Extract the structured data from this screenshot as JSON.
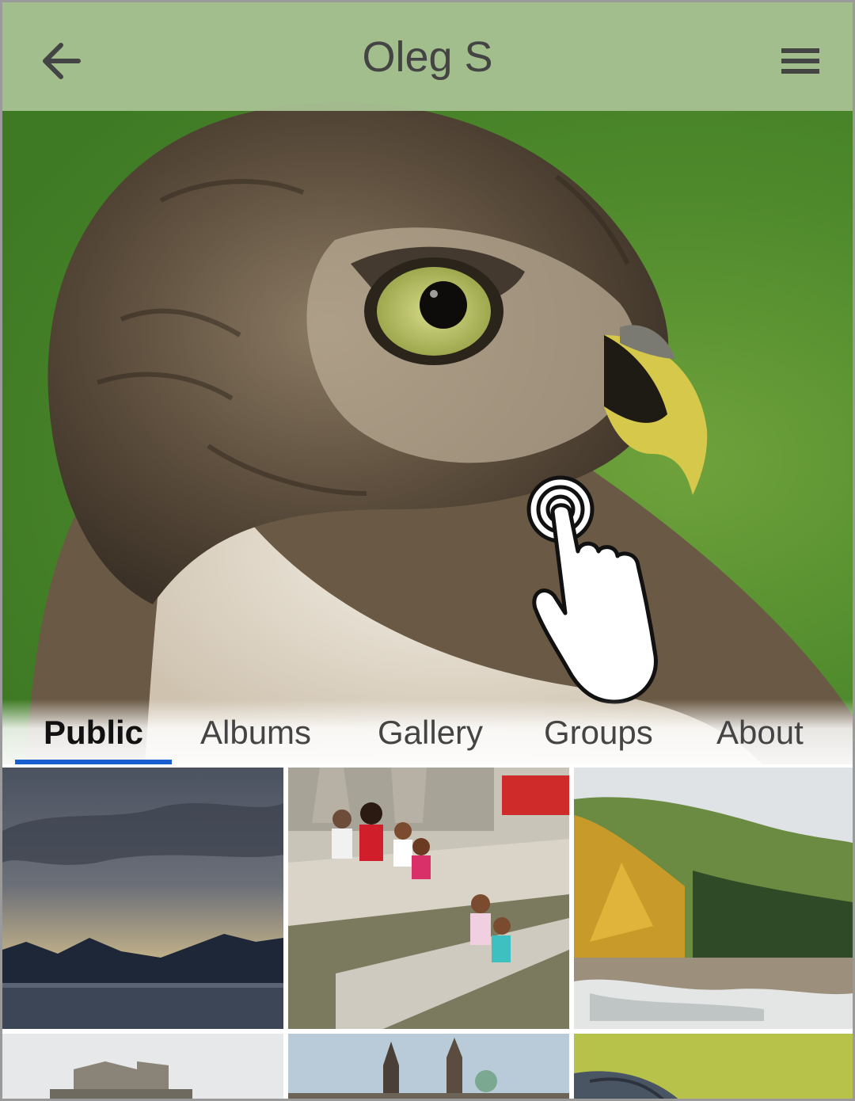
{
  "header": {
    "title": "Oleg S",
    "back_icon": "arrow-left-icon",
    "menu_icon": "hamburger-menu-icon"
  },
  "cover": {
    "image": "hawk-portrait-photo"
  },
  "tabs": [
    {
      "label": "Public",
      "active": true
    },
    {
      "label": "Albums",
      "active": false
    },
    {
      "label": "Gallery",
      "active": false
    },
    {
      "label": "Groups",
      "active": false
    },
    {
      "label": "About",
      "active": false
    }
  ],
  "photos": [
    {
      "image": "lake-mountains-sunset-photo"
    },
    {
      "image": "family-on-steps-photo"
    },
    {
      "image": "autumn-forest-river-photo"
    },
    {
      "image": "old-building-photo"
    },
    {
      "image": "city-towers-photo"
    },
    {
      "image": "bird-in-flight-photo"
    }
  ],
  "gesture": {
    "icon": "tap-gesture-hand-icon"
  },
  "colors": {
    "accent": "#1a5fd0",
    "topbar": "#aac396"
  }
}
